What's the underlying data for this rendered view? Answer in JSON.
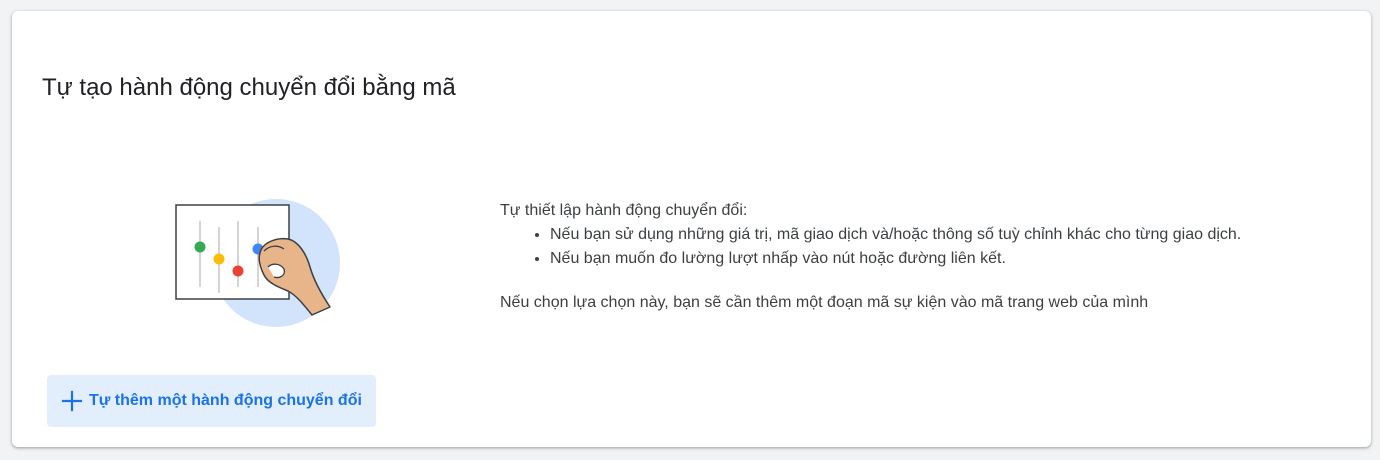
{
  "card": {
    "title": "Tự tạo hành động chuyển đổi bằng mã",
    "illustration_icon": "hand-adjusting-sliders-illustration"
  },
  "description": {
    "intro": "Tự thiết lập hành động chuyển đổi:",
    "bullets": [
      "Nếu bạn sử dụng những giá trị, mã giao dịch và/hoặc thông số tuỳ chỉnh khác cho từng giao dịch.",
      "Nếu bạn muốn đo lường lượt nhấp vào nút hoặc đường liên kết."
    ],
    "note": "Nếu chọn lựa chọn này, bạn sẽ cần thêm một đoạn mã sự kiện vào mã trang web của mình"
  },
  "actions": {
    "add_label": "Tự thêm một hành động chuyển đổi",
    "add_icon": "plus-icon"
  },
  "colors": {
    "accent": "#1a73e8",
    "button_bg": "#e3eefc",
    "illustration_circle": "#d2e3fc",
    "green": "#34a853",
    "yellow": "#fbbc04",
    "red": "#ea4335",
    "blue": "#4285f4",
    "skin": "#e8b48a"
  }
}
